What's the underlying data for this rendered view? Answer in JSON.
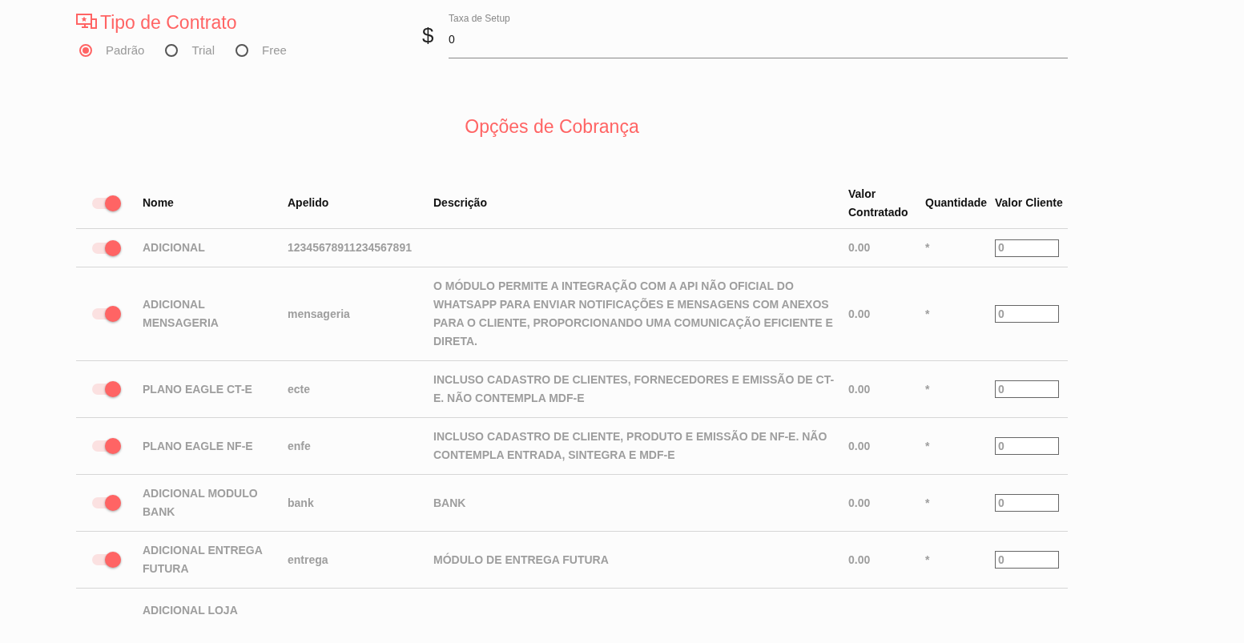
{
  "contract_type": {
    "title": "Tipo de Contrato",
    "options": [
      {
        "label": "Padrão",
        "selected": true
      },
      {
        "label": "Trial",
        "selected": false
      },
      {
        "label": "Free",
        "selected": false
      }
    ]
  },
  "setup_fee": {
    "currency_symbol": "$",
    "label": "Taxa de Setup",
    "value": "0"
  },
  "billing": {
    "title": "Opções de Cobrança",
    "header_toggle": {
      "on": true
    },
    "columns": [
      "Nome",
      "Apelido",
      "Descrição",
      "Valor Contratado",
      "Quantidade",
      "Valor Cliente"
    ],
    "rows": [
      {
        "on": true,
        "name": "ADICIONAL",
        "nickname": "12345678911234567891",
        "description": "",
        "contracted_value": "0.00",
        "quantity": "*",
        "client_value": "0"
      },
      {
        "on": true,
        "name": "ADICIONAL MENSAGERIA",
        "nickname": "mensageria",
        "description": "O MÓDULO PERMITE A INTEGRAÇÃO COM A API NÃO OFICIAL DO WHATSAPP PARA ENVIAR NOTIFICAÇÕES E MENSAGENS COM ANEXOS PARA O CLIENTE, PROPORCIONANDO UMA COMUNICAÇÃO EFICIENTE E DIRETA.",
        "contracted_value": "0.00",
        "quantity": "*",
        "client_value": "0"
      },
      {
        "on": true,
        "name": "PLANO EAGLE CT-E",
        "nickname": "ecte",
        "description": "INCLUSO CADASTRO DE CLIENTES, FORNECEDORES E EMISSÃO DE CT-E. NÃO CONTEMPLA MDF-E",
        "contracted_value": "0.00",
        "quantity": "*",
        "client_value": "0"
      },
      {
        "on": true,
        "name": "PLANO EAGLE NF-E",
        "nickname": "enfe",
        "description": "INCLUSO CADASTRO DE CLIENTE, PRODUTO E EMISSÃO DE NF-E. NÃO CONTEMPLA ENTRADA, SINTEGRA E MDF-E",
        "contracted_value": "0.00",
        "quantity": "*",
        "client_value": "0"
      },
      {
        "on": true,
        "name": "ADICIONAL MODULO BANK",
        "nickname": "bank",
        "description": "BANK",
        "contracted_value": "0.00",
        "quantity": "*",
        "client_value": "0"
      },
      {
        "on": true,
        "name": "ADICIONAL ENTREGA FUTURA",
        "nickname": "entrega",
        "description": "MÓDULO DE ENTREGA FUTURA",
        "contracted_value": "0.00",
        "quantity": "*",
        "client_value": "0"
      },
      {
        "name": "ADICIONAL LOJA"
      }
    ]
  }
}
